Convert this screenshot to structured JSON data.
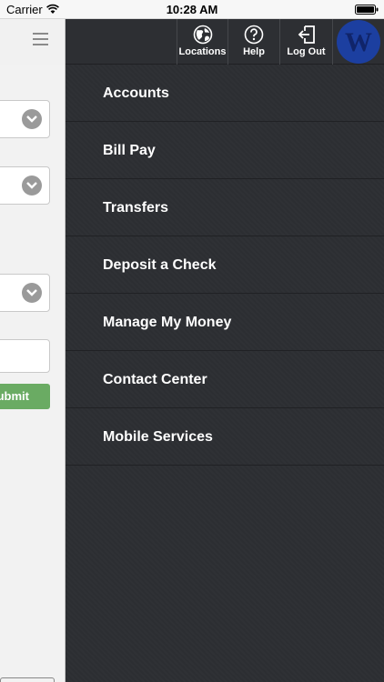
{
  "status_bar": {
    "carrier": "Carrier",
    "time": "10:28 AM"
  },
  "behind_page": {
    "submit_label": "Submit"
  },
  "top_nav": {
    "locations_label": "Locations",
    "help_label": "Help",
    "logout_label": "Log Out",
    "logo_letter": "W"
  },
  "menu": {
    "items": [
      {
        "label": "Accounts"
      },
      {
        "label": "Bill Pay"
      },
      {
        "label": "Transfers"
      },
      {
        "label": "Deposit a Check"
      },
      {
        "label": "Manage My Money"
      },
      {
        "label": "Contact Center"
      },
      {
        "label": "Mobile Services"
      }
    ]
  },
  "colors": {
    "menu_background": "#2c2e32",
    "submit_green": "#6aab63",
    "logo_blue": "#1c3fa0"
  },
  "icons": [
    "wifi-icon",
    "battery-icon",
    "hamburger-icon",
    "chevron-down-icon",
    "globe-icon",
    "help-icon",
    "logout-icon",
    "logo-icon"
  ]
}
